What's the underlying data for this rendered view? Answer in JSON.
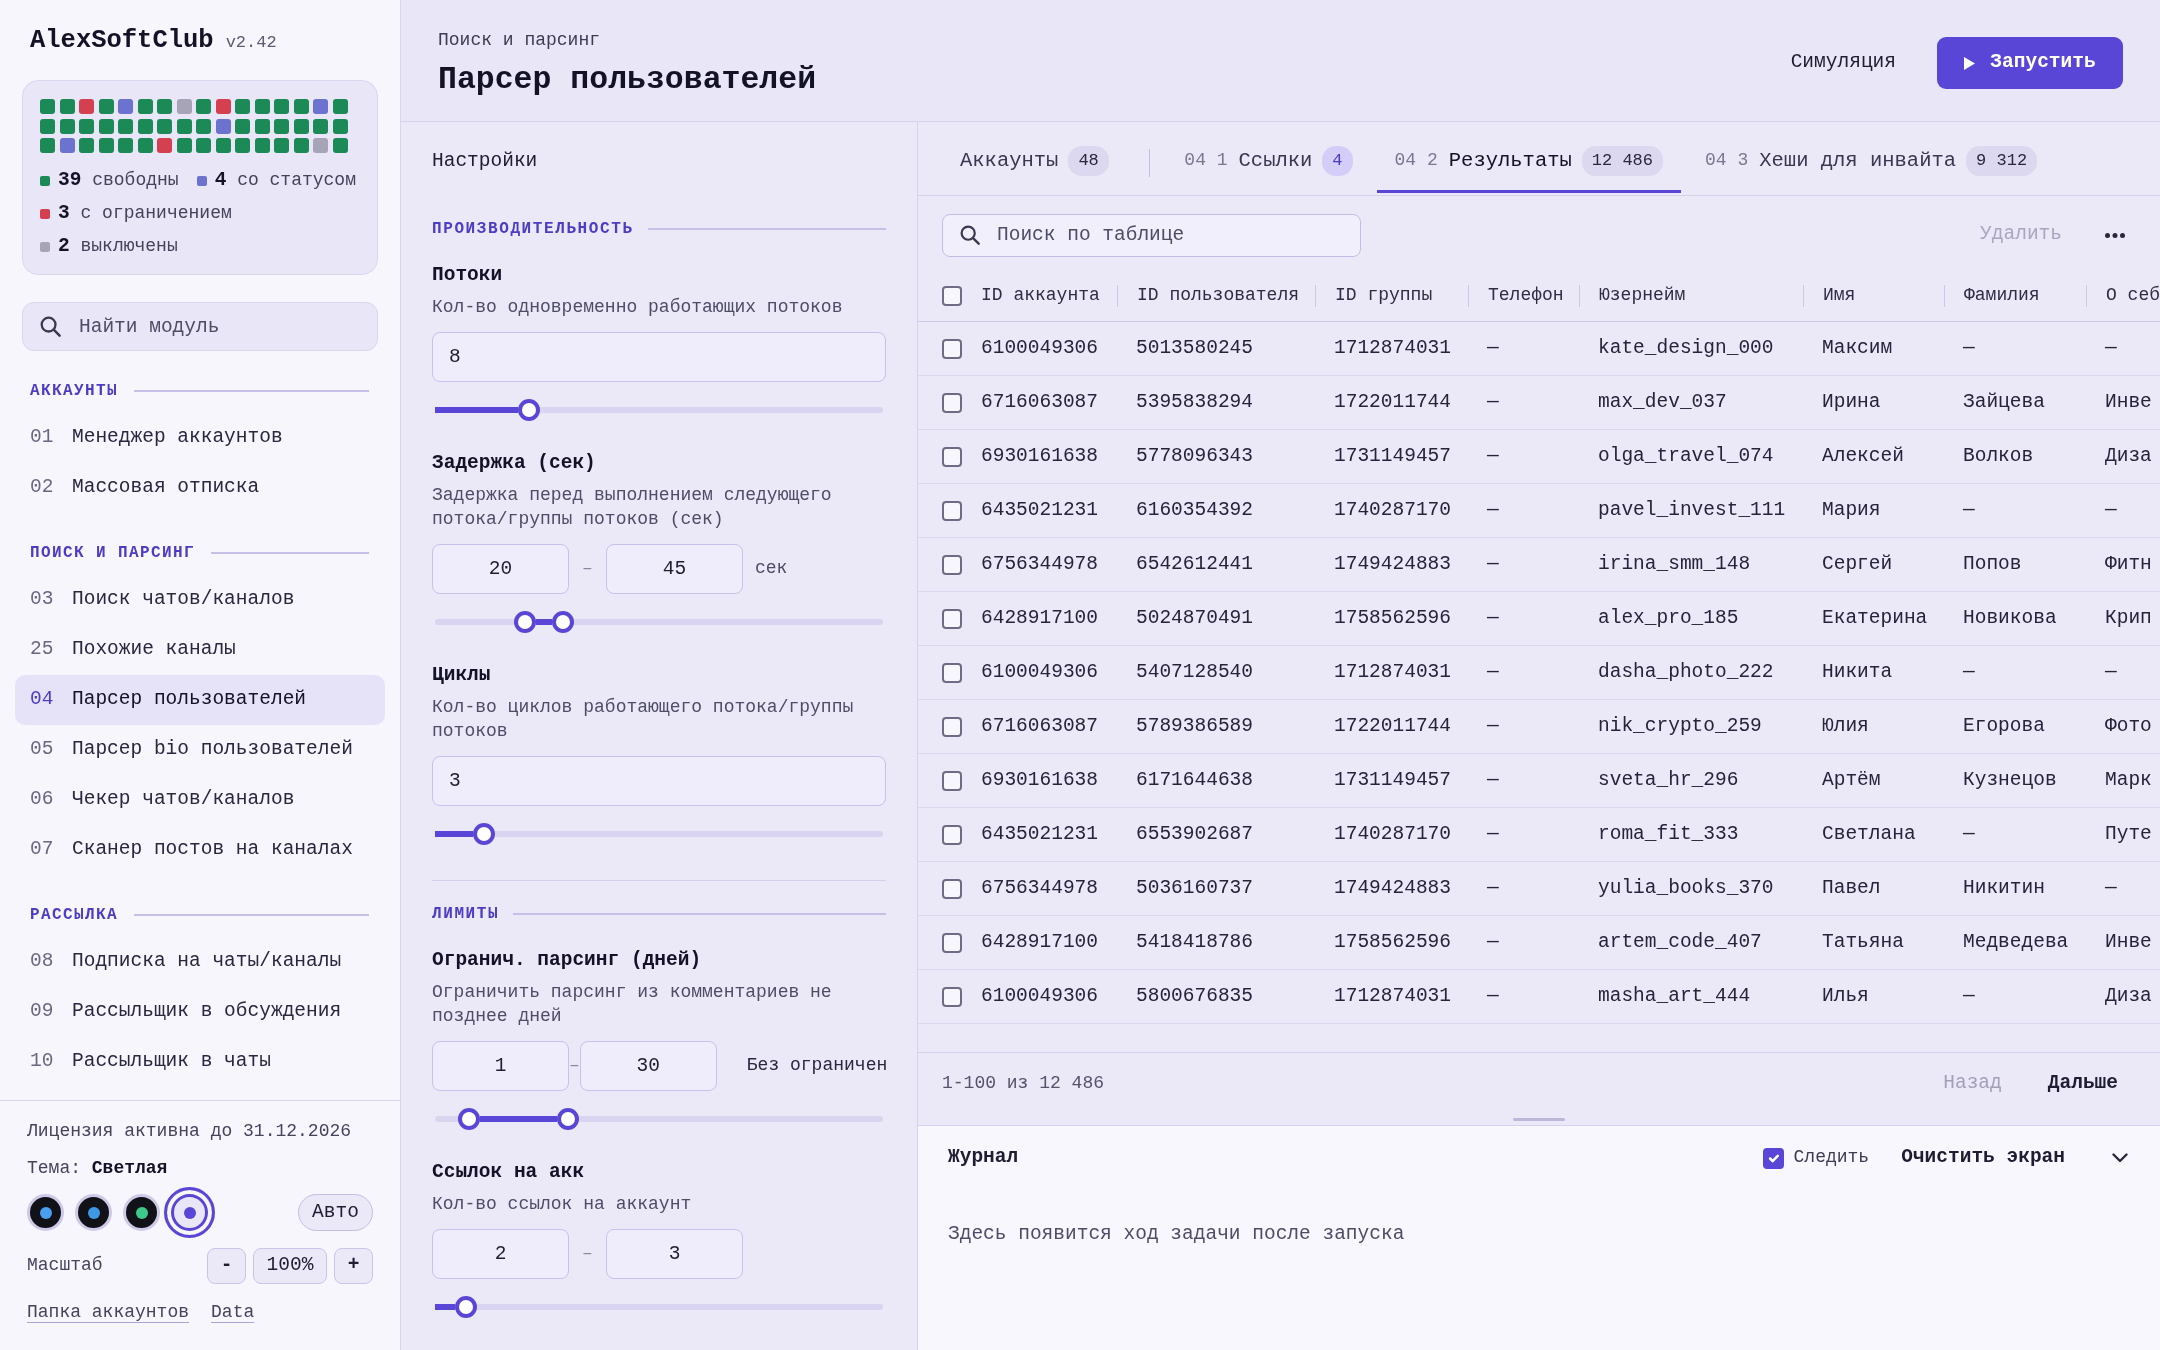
{
  "sidebar": {
    "brand": {
      "name": "AlexSoftClub",
      "version": "v2.42"
    },
    "account_grid": {
      "cells": [
        {
          "color": "#1b8a56"
        },
        {
          "color": "#1b8a56"
        },
        {
          "color": "#d4404f"
        },
        {
          "color": "#1b8a56"
        },
        {
          "color": "#6c72d0"
        },
        {
          "color": "#1b8a56"
        },
        {
          "color": "#1b8a56"
        },
        {
          "color": "#a6a4b6"
        },
        {
          "color": "#1b8a56"
        },
        {
          "color": "#d4404f"
        },
        {
          "color": "#1b8a56"
        },
        {
          "color": "#1b8a56"
        },
        {
          "color": "#1b8a56"
        },
        {
          "color": "#1b8a56"
        },
        {
          "color": "#6c72d0"
        },
        {
          "color": "#1b8a56"
        },
        {
          "color": "#1b8a56"
        },
        {
          "color": "#1b8a56"
        },
        {
          "color": "#1b8a56"
        },
        {
          "color": "#1b8a56"
        },
        {
          "color": "#1b8a56"
        },
        {
          "color": "#1b8a56"
        },
        {
          "color": "#1b8a56"
        },
        {
          "color": "#1b8a56"
        },
        {
          "color": "#1b8a56"
        },
        {
          "color": "#6c72d0"
        },
        {
          "color": "#1b8a56"
        },
        {
          "color": "#1b8a56"
        },
        {
          "color": "#1b8a56"
        },
        {
          "color": "#1b8a56"
        },
        {
          "color": "#1b8a56"
        },
        {
          "color": "#1b8a56"
        },
        {
          "color": "#1b8a56"
        },
        {
          "color": "#6c72d0"
        },
        {
          "color": "#1b8a56"
        },
        {
          "color": "#1b8a56"
        },
        {
          "color": "#1b8a56"
        },
        {
          "color": "#1b8a56"
        },
        {
          "color": "#d4404f"
        },
        {
          "color": "#1b8a56"
        },
        {
          "color": "#1b8a56"
        },
        {
          "color": "#1b8a56"
        },
        {
          "color": "#1b8a56"
        },
        {
          "color": "#1b8a56"
        },
        {
          "color": "#1b8a56"
        },
        {
          "color": "#1b8a56"
        },
        {
          "color": "#a6a4b6"
        },
        {
          "color": "#1b8a56"
        }
      ],
      "legend": [
        {
          "count": "39",
          "label": "свободны",
          "color": "#1b8a56"
        },
        {
          "count": "4",
          "label": "со статусом",
          "color": "#6c72d0"
        },
        {
          "count": "3",
          "label": "с ограничением",
          "color": "#d4404f"
        },
        {
          "count": "2",
          "label": "выключены",
          "color": "#a6a4b6"
        }
      ]
    },
    "search": {
      "placeholder": "Найти модуль"
    },
    "sections": [
      {
        "title": "АККАУНТЫ",
        "items": [
          {
            "number": "01",
            "label": "Менеджер аккаунтов",
            "selected": false
          },
          {
            "number": "02",
            "label": "Массовая отписка",
            "selected": false
          }
        ]
      },
      {
        "title": "ПОИСК И ПАРСИНГ",
        "items": [
          {
            "number": "03",
            "label": "Поиск чатов/каналов",
            "selected": false
          },
          {
            "number": "25",
            "label": "Похожие каналы",
            "selected": false
          },
          {
            "number": "04",
            "label": "Парсер пользователей",
            "selected": true
          },
          {
            "number": "05",
            "label": "Парсер bio пользователей",
            "selected": false
          },
          {
            "number": "06",
            "label": "Чекер чатов/каналов",
            "selected": false
          },
          {
            "number": "07",
            "label": "Сканер постов на каналах",
            "selected": false
          }
        ]
      },
      {
        "title": "РАССЫЛКА",
        "items": [
          {
            "number": "08",
            "label": "Подписка на чаты/каналы",
            "selected": false
          },
          {
            "number": "09",
            "label": "Рассыльщик в обсуждения",
            "selected": false
          },
          {
            "number": "10",
            "label": "Рассыльщик в чаты",
            "selected": false
          }
        ]
      }
    ],
    "license": "Лицензия активна до 31.12.2026",
    "theme": {
      "label": "Тема:",
      "value": "Светлая",
      "swatches": [
        {
          "kind": "dark",
          "color": "#4aa0f0",
          "selected": false
        },
        {
          "kind": "dark",
          "color": "#3f98e6",
          "selected": false
        },
        {
          "kind": "dark",
          "color": "#3cc98a",
          "selected": false
        },
        {
          "kind": "light",
          "color": "#5a46d6",
          "selected": true
        }
      ],
      "auto_button": "Авто"
    },
    "scale": {
      "label": "Масштаб",
      "decrease": "-",
      "value": "100%",
      "increase": "+"
    },
    "links": [
      "Папка аккаунтов",
      "Data"
    ]
  },
  "header": {
    "breadcrumb": "Поиск и парсинг",
    "title": "Парсер пользователей",
    "actions": [
      {
        "kind": "ghost",
        "label": "Симуляция"
      },
      {
        "kind": "primary",
        "label": "Запустить"
      }
    ]
  },
  "settings": {
    "title": "Настройки",
    "groups": [
      {
        "title": "ПРОИЗВОДИТЕЛЬНОСТЬ",
        "fields": [
          {
            "kind": "single",
            "label": "Потоки",
            "description": "Кол-во одновременно работающих потоков",
            "value": "8",
            "level": 0.21
          },
          {
            "kind": "range",
            "label": "Задержка (сек)",
            "description": "Задержка перед выполнением следующего потока/группы потоков (сек)",
            "range": [
              {
                "value": "20",
                "level": 0.2
              },
              {
                "value": "45",
                "level": 0.285
              }
            ],
            "separator": "–",
            "unit": "сек"
          },
          {
            "kind": "single",
            "label": "Циклы",
            "description": "Кол-во циклов работающего потока/группы потоков",
            "value": "3",
            "level": 0.11
          }
        ]
      },
      {
        "title": "ЛИМИТЫ",
        "fields": [
          {
            "kind": "range",
            "label": "Огранич. парсинг (дней)",
            "description": "Ограничить парсинг из комментариев не позднее дней",
            "range": [
              {
                "value": "1",
                "level": 0.075
              },
              {
                "value": "30",
                "level": 0.297
              }
            ],
            "separator": "–",
            "option": "Без ограничен"
          },
          {
            "kind": "range",
            "label": "Ссылок на акк",
            "description": "Кол-во ссылок на аккаунт",
            "range": [
              {
                "value": "2"
              },
              {
                "value": "3"
              }
            ],
            "separator": "–",
            "level": 0.07
          }
        ]
      }
    ]
  },
  "results": {
    "tabs": [
      {
        "label": "Аккаунты",
        "count": "48",
        "count_highlighted": false,
        "selected": false
      },
      {
        "prefix": "04 1",
        "label": "Ссылки",
        "count": "4",
        "count_highlighted": true,
        "selected": false
      },
      {
        "prefix": "04 2",
        "label": "Результаты",
        "count": "12 486",
        "count_highlighted": false,
        "selected": true
      },
      {
        "prefix": "04 3",
        "label": "Хеши для инвайта",
        "count": "9 312",
        "count_highlighted": false,
        "selected": false
      }
    ],
    "toolbar": {
      "search_placeholder": "Поиск по таблице",
      "delete_button": {
        "label": "Удалить",
        "disabled": true
      }
    },
    "table": {
      "select_all": {
        "checked": false
      },
      "columns": [
        "ID аккаунта",
        "ID пользователя",
        "ID группы",
        "Телефон",
        "Юзернейм",
        "Имя",
        "Фамилия",
        "О себ"
      ],
      "rows": [
        {
          "checked": false,
          "cells": [
            "6100049306",
            "5013580245",
            "1712874031",
            "—",
            "kate_design_000",
            "Максим",
            "—",
            "—"
          ]
        },
        {
          "checked": false,
          "cells": [
            "6716063087",
            "5395838294",
            "1722011744",
            "—",
            "max_dev_037",
            "Ирина",
            "Зайцева",
            "Инве"
          ]
        },
        {
          "checked": false,
          "cells": [
            "6930161638",
            "5778096343",
            "1731149457",
            "—",
            "olga_travel_074",
            "Алексей",
            "Волков",
            "Диза"
          ]
        },
        {
          "checked": false,
          "cells": [
            "6435021231",
            "6160354392",
            "1740287170",
            "—",
            "pavel_invest_111",
            "Мария",
            "—",
            "—"
          ]
        },
        {
          "checked": false,
          "cells": [
            "6756344978",
            "6542612441",
            "1749424883",
            "—",
            "irina_smm_148",
            "Сергей",
            "Попов",
            "Фитн"
          ]
        },
        {
          "checked": false,
          "cells": [
            "6428917100",
            "5024870491",
            "1758562596",
            "—",
            "alex_pro_185",
            "Екатерина",
            "Новикова",
            "Крип"
          ]
        },
        {
          "checked": false,
          "cells": [
            "6100049306",
            "5407128540",
            "1712874031",
            "—",
            "dasha_photo_222",
            "Никита",
            "—",
            "—"
          ]
        },
        {
          "checked": false,
          "cells": [
            "6716063087",
            "5789386589",
            "1722011744",
            "—",
            "nik_crypto_259",
            "Юлия",
            "Егорова",
            "Фото"
          ]
        },
        {
          "checked": false,
          "cells": [
            "6930161638",
            "6171644638",
            "1731149457",
            "—",
            "sveta_hr_296",
            "Артём",
            "Кузнецов",
            "Марк"
          ]
        },
        {
          "checked": false,
          "cells": [
            "6435021231",
            "6553902687",
            "1740287170",
            "—",
            "roma_fit_333",
            "Светлана",
            "—",
            "Путе"
          ]
        },
        {
          "checked": false,
          "cells": [
            "6756344978",
            "5036160737",
            "1749424883",
            "—",
            "yulia_books_370",
            "Павел",
            "Никитин",
            "—"
          ]
        },
        {
          "checked": false,
          "cells": [
            "6428917100",
            "5418418786",
            "1758562596",
            "—",
            "artem_code_407",
            "Татьяна",
            "Медведева",
            "Инве"
          ]
        },
        {
          "checked": false,
          "cells": [
            "6100049306",
            "5800676835",
            "1712874031",
            "—",
            "masha_art_444",
            "Илья",
            "—",
            "Диза"
          ]
        }
      ]
    },
    "pagination": {
      "range": "1-100 из 12 486",
      "prev": {
        "label": "Назад",
        "disabled": true
      },
      "next": {
        "label": "Дальше",
        "disabled": false
      }
    },
    "log": {
      "title": "Журнал",
      "follow": {
        "label": "Следить",
        "checked": true
      },
      "clear_button": "Очистить экран",
      "empty_text": "Здесь появится ход задачи после запуска"
    }
  }
}
